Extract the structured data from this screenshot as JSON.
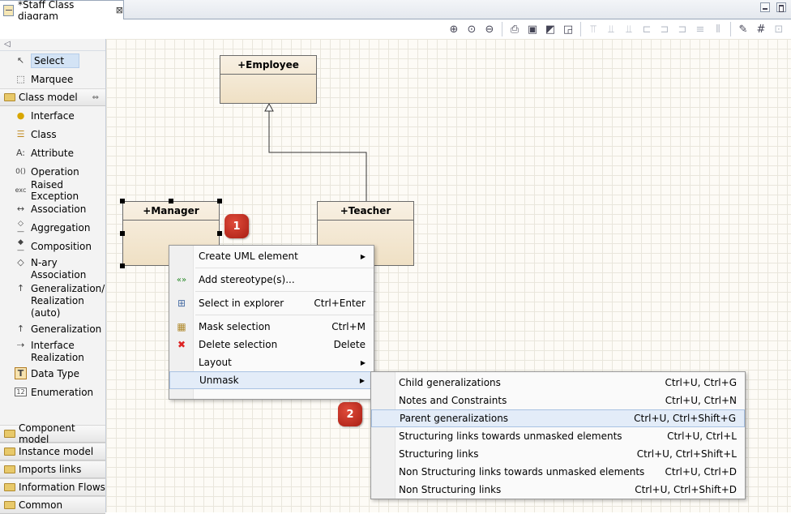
{
  "tab": {
    "title": "*Staff Class diagram",
    "close": "⊠"
  },
  "palette": {
    "collapse_arrow": "◁",
    "tools": [
      {
        "icon": "↖",
        "label": "Select"
      },
      {
        "icon": "⬚",
        "label": "Marquee"
      }
    ],
    "drawer_open": {
      "label": "Class model",
      "collapse": "⇔"
    },
    "items": [
      {
        "icon": "●",
        "label": "Interface"
      },
      {
        "icon": "☰",
        "label": "Class"
      },
      {
        "icon": "A:",
        "label": "Attribute"
      },
      {
        "icon": "0()",
        "label": "Operation"
      },
      {
        "icon": "exc",
        "label": "Raised Exception"
      },
      {
        "icon": "↔",
        "label": "Association"
      },
      {
        "icon": "◇—",
        "label": "Aggregation"
      },
      {
        "icon": "◆—",
        "label": "Composition"
      },
      {
        "icon": "◇",
        "label1": "N-ary",
        "label2": "Association"
      },
      {
        "icon": "↑",
        "label1": "Generalization/",
        "label2": "Realization",
        "label3": "(auto)"
      },
      {
        "icon": "↑",
        "label": "Generalization"
      },
      {
        "icon": "⇢",
        "label1": "Interface",
        "label2": "Realization"
      },
      {
        "icon": "T",
        "label": "Data Type"
      },
      {
        "icon": "12",
        "label": "Enumeration"
      }
    ],
    "drawers": [
      {
        "label": "Component model"
      },
      {
        "label": "Instance model"
      },
      {
        "label": "Imports links"
      },
      {
        "label": "Information Flows"
      },
      {
        "label": "Common"
      }
    ]
  },
  "diagram": {
    "classes": [
      {
        "name": "+Employee"
      },
      {
        "name": "+Manager"
      },
      {
        "name": "+Teacher"
      }
    ],
    "badges": [
      "1",
      "2"
    ]
  },
  "context_menu": {
    "items": [
      {
        "label": "Create UML element",
        "shortcut": "",
        "submenu": "▶",
        "icon": ""
      },
      {
        "label": "Add stereotype(s)...",
        "shortcut": "",
        "submenu": "",
        "icon": "«»"
      },
      {
        "label": "Select in explorer",
        "shortcut": "Ctrl+Enter",
        "submenu": "",
        "icon": "⊞"
      },
      {
        "label": "Mask selection",
        "shortcut": "Ctrl+M",
        "submenu": "",
        "icon": "▦"
      },
      {
        "label": "Delete selection",
        "shortcut": "Delete",
        "submenu": "",
        "icon": "✖"
      },
      {
        "label": "Layout",
        "shortcut": "",
        "submenu": "▶",
        "icon": ""
      },
      {
        "label": "Unmask",
        "shortcut": "",
        "submenu": "▶",
        "icon": ""
      }
    ]
  },
  "unmask_menu": {
    "items": [
      {
        "label": "Child generalizations",
        "shortcut": "Ctrl+U, Ctrl+G"
      },
      {
        "label": "Notes and Constraints",
        "shortcut": "Ctrl+U, Ctrl+N"
      },
      {
        "label": "Parent generalizations",
        "shortcut": "Ctrl+U, Ctrl+Shift+G"
      },
      {
        "label": "Structuring links towards unmasked elements",
        "shortcut": "Ctrl+U, Ctrl+L"
      },
      {
        "label": "Structuring links",
        "shortcut": "Ctrl+U, Ctrl+Shift+L"
      },
      {
        "label": "Non Structuring links towards unmasked elements",
        "shortcut": "Ctrl+U, Ctrl+D"
      },
      {
        "label": "Non Structuring links",
        "shortcut": "Ctrl+U, Ctrl+Shift+D"
      }
    ]
  },
  "colors": {
    "badge": "#c0392b",
    "highlight": "#e3ecf8",
    "class_fill": "#f3e6cd"
  }
}
